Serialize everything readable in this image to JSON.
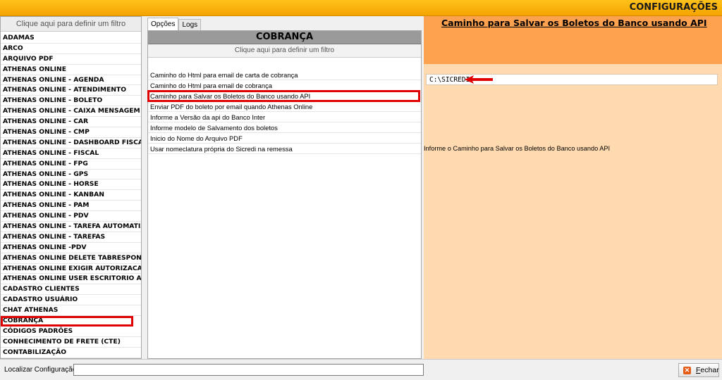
{
  "window": {
    "title": "CONFIGURAÇÕES"
  },
  "left_panel": {
    "filter_text": "Clique aqui para definir um filtro",
    "items": [
      "ADAMAS",
      "ARCO",
      "ARQUIVO PDF",
      "ATHENAS ONLINE",
      "ATHENAS ONLINE - AGENDA",
      "ATHENAS ONLINE - ATENDIMENTO",
      "ATHENAS ONLINE - BOLETO",
      "ATHENAS ONLINE - CAIXA MENSAGEM",
      "ATHENAS ONLINE - CAR",
      "ATHENAS ONLINE - CMP",
      "ATHENAS ONLINE - DASHBOARD FISCAL",
      "ATHENAS ONLINE - FISCAL",
      "ATHENAS ONLINE - FPG",
      "ATHENAS ONLINE - GPS",
      "ATHENAS ONLINE - HORSE",
      "ATHENAS ONLINE - KANBAN",
      "ATHENAS ONLINE - PAM",
      "ATHENAS ONLINE - PDV",
      "ATHENAS ONLINE - TAREFA AUTOMATIZ/",
      "ATHENAS ONLINE - TAREFAS",
      "ATHENAS ONLINE -PDV",
      "ATHENAS ONLINE DELETE TABRESPONSA\\",
      "ATHENAS ONLINE EXIGIR AUTORIZACAO",
      "ATHENAS ONLINE USER ESCRITORIO AV/",
      "CADASTRO CLIENTES",
      "CADASTRO USUÁRIO",
      "CHAT ATHENAS",
      "COBRANÇA",
      "CÓDIGOS PADRÕES",
      "CONHECIMENTO DE FRETE (CTE)",
      "CONTABILIZAÇÃO"
    ],
    "selected_index": 27
  },
  "tabs": [
    {
      "label": "Opções"
    },
    {
      "label": "Logs"
    }
  ],
  "middle_panel": {
    "header": "COBRANÇA",
    "filter_text": "Clique aqui para definir um filtro",
    "items": [
      "Caminho do Html para email de carta de cobrança",
      "Caminho do Html para email de cobrança",
      "Caminho para Salvar os Boletos do Banco usando API",
      "Enviar PDF do boleto por email quando Athenas Online",
      "Informe a Versão da api do Banco Inter",
      "Informe modelo de Salvamento dos boletos",
      "Inicio do Nome do Arquivo PDF",
      "Usar nomeclatura própria do Sicredi na remessa"
    ],
    "selected_index": 2
  },
  "right_panel": {
    "title": "Caminho para Salvar os Boletos do Banco usando API",
    "value": "C:\\SICREDI",
    "description": "Informe o Caminho para Salvar os Boletos do Banco usando API"
  },
  "bottom_bar": {
    "search_label": "Localizar Configuração:",
    "search_value": "",
    "close_label": "Fechar",
    "close_icon": "close-x-icon"
  },
  "colors": {
    "title_bar": "#ffb300",
    "right_header": "#ffa24f",
    "right_body": "#ffdab0",
    "highlight": "#e00000"
  }
}
